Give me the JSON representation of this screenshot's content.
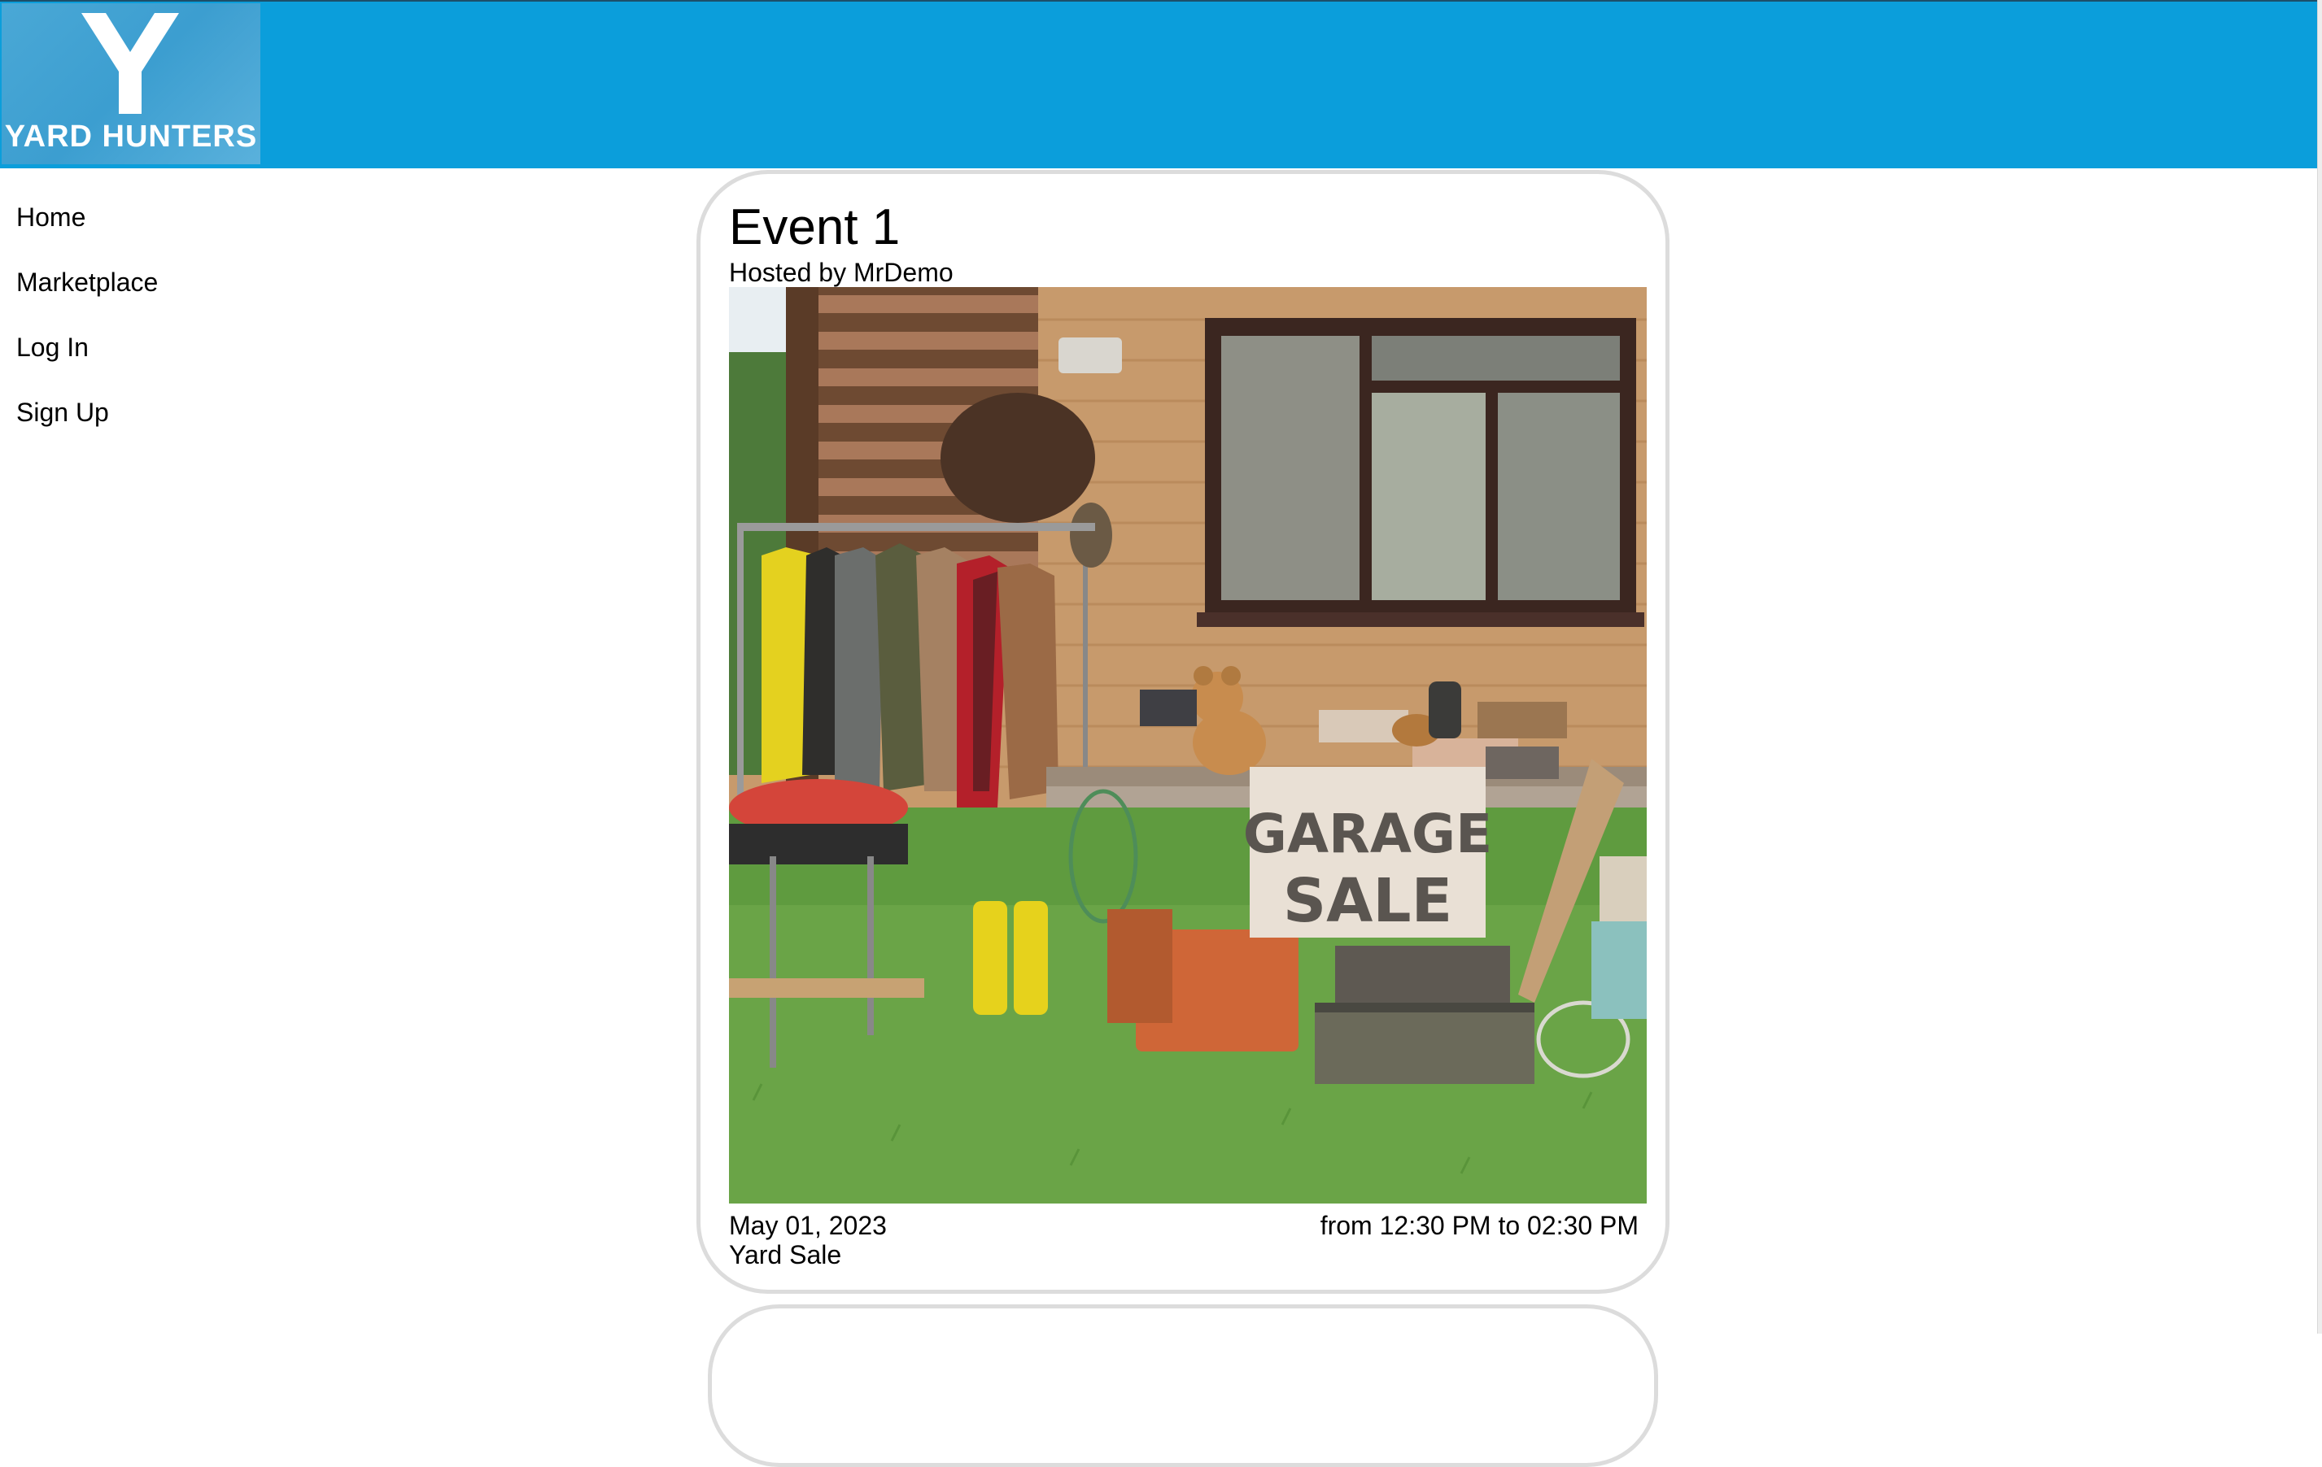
{
  "brand": {
    "logo_text": "YARD HUNTERS",
    "header_color": "#0b9edb"
  },
  "nav": {
    "items": [
      {
        "label": "Home"
      },
      {
        "label": "Marketplace"
      },
      {
        "label": "Log In"
      },
      {
        "label": "Sign Up"
      }
    ]
  },
  "events": [
    {
      "title": "Event 1",
      "host": "Hosted by MrDemo",
      "image_alt": "garage-sale-photo",
      "date": "May 01, 2023",
      "time": "from 12:30 PM to 02:30 PM",
      "type": "Yard Sale",
      "sign_text": [
        "GARAGE",
        "SALE"
      ]
    }
  ]
}
